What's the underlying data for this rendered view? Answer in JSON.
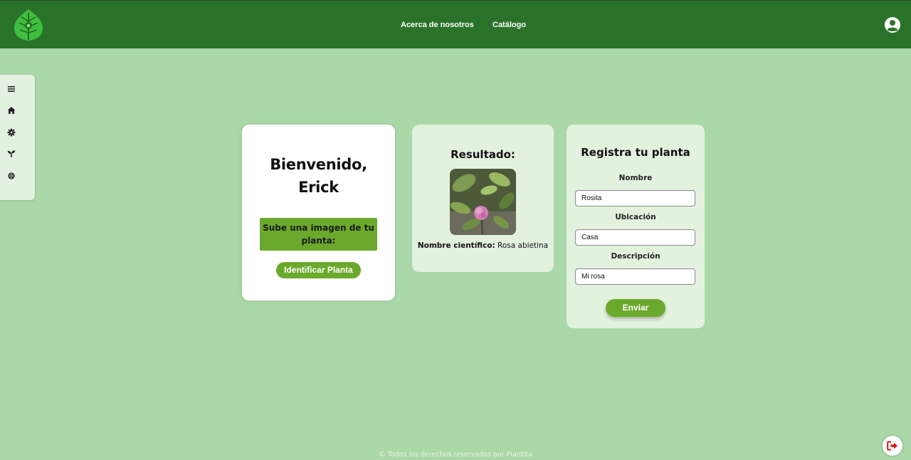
{
  "header": {
    "nav": {
      "about": "Acerca de nosotros",
      "catalog": "Catálogo"
    },
    "logo_icon": "leaf-logo-icon",
    "user_icon": "user-circle-icon",
    "colors": {
      "bar": "#2a722a",
      "accent": "#6ba92c",
      "background": "#aad8a8"
    }
  },
  "sidebar": {
    "items": [
      {
        "icon": "menu-icon"
      },
      {
        "icon": "home-icon"
      },
      {
        "icon": "gear-icon"
      },
      {
        "icon": "sprout-icon"
      },
      {
        "icon": "brain-icon"
      }
    ]
  },
  "welcome": {
    "title_line1": "Bienvenido,",
    "title_line2": "Erick",
    "upload_prompt": "Sube una imagen de tu planta:",
    "identify_button": "Identificar Planta"
  },
  "result": {
    "title": "Resultado:",
    "scientific_name_label": "Nombre científico:",
    "scientific_name_value": " Rosa abietina"
  },
  "register": {
    "title": "Registra tu planta",
    "name_label": "Nombre",
    "name_value": "Rosita",
    "location_label": "Ubicación",
    "location_value": "Casa",
    "description_label": "Descripción",
    "description_value": "Mi rosa",
    "send_button": "Enviar"
  },
  "footer": {
    "copyright": "© Todos los derechos reservados por Plantita"
  },
  "logout_icon": "logout-icon"
}
